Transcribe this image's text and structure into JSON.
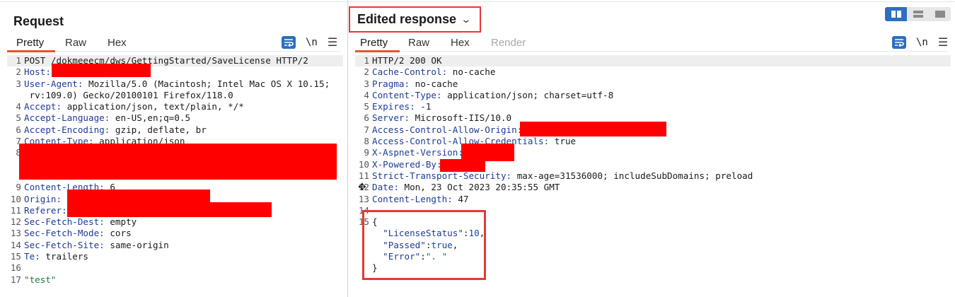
{
  "request": {
    "title": "Request",
    "tabs": [
      "Pretty",
      "Raw",
      "Hex"
    ],
    "newline_label": "\\n",
    "lines": [
      {
        "n": "1",
        "key": "POST /dokmeeecm/dws/GettingStarted/SaveLicense HTTP/2",
        "val": ""
      },
      {
        "n": "2",
        "key": "Host:",
        "val": ""
      },
      {
        "n": "3",
        "key": "User-Agent:",
        "val": " Mozilla/5.0 (Macintosh; Intel Mac OS X 10.15;"
      },
      {
        "n": "",
        "key": "",
        "val": " rv:109.0) Gecko/20100101 Firefox/118.0"
      },
      {
        "n": "4",
        "key": "Accept:",
        "val": " application/json, text/plain, */*"
      },
      {
        "n": "5",
        "key": "Accept-Language:",
        "val": " en-US,en;q=0.5"
      },
      {
        "n": "6",
        "key": "Accept-Encoding:",
        "val": " gzip, deflate, br"
      },
      {
        "n": "7",
        "key": "Content-Type:",
        "val": " application/json"
      },
      {
        "n": "8",
        "key": "",
        "val": ""
      },
      {
        "n": "",
        "key": "",
        "val": ""
      },
      {
        "n": "",
        "key": "",
        "val": ""
      },
      {
        "n": "9",
        "key": "Content-Length:",
        "val": " 6"
      },
      {
        "n": "10",
        "key": "Origin:",
        "val": ""
      },
      {
        "n": "11",
        "key": "Referer:",
        "val": ""
      },
      {
        "n": "12",
        "key": "Sec-Fetch-Dest:",
        "val": " empty"
      },
      {
        "n": "13",
        "key": "Sec-Fetch-Mode:",
        "val": " cors"
      },
      {
        "n": "14",
        "key": "Sec-Fetch-Site:",
        "val": " same-origin"
      },
      {
        "n": "15",
        "key": "Te:",
        "val": " trailers"
      },
      {
        "n": "16",
        "key": "",
        "val": ""
      },
      {
        "n": "17",
        "key": "",
        "val": "\"test\""
      }
    ]
  },
  "response": {
    "title": "Edited response",
    "tabs": [
      "Pretty",
      "Raw",
      "Hex",
      "Render"
    ],
    "newline_label": "\\n",
    "lines": [
      {
        "n": "1",
        "key": "HTTP/2 200 OK",
        "val": ""
      },
      {
        "n": "2",
        "key": "Cache-Control:",
        "val": " no-cache"
      },
      {
        "n": "3",
        "key": "Pragma:",
        "val": " no-cache"
      },
      {
        "n": "4",
        "key": "Content-Type:",
        "val": " application/json; charset=utf-8"
      },
      {
        "n": "5",
        "key": "Expires:",
        "val": " -1"
      },
      {
        "n": "6",
        "key": "Server:",
        "val": " Microsoft-IIS/10.0"
      },
      {
        "n": "7",
        "key": "Access-Control-Allow-Origin:",
        "val": ""
      },
      {
        "n": "8",
        "key": "Access-Control-Allow-Credentials:",
        "val": " true"
      },
      {
        "n": "9",
        "key": "X-Aspnet-Version:",
        "val": ""
      },
      {
        "n": "10",
        "key": "X-Powered-By:",
        "val": ""
      },
      {
        "n": "11",
        "key": "Strict-Transport-Security:",
        "val": " max-age=31536000; includeSubDomains; preload"
      },
      {
        "n": "12",
        "key": "Date:",
        "val": " Mon, 23 Oct 2023 20:35:55 GMT"
      },
      {
        "n": "13",
        "key": "Content-Length:",
        "val": " 47"
      },
      {
        "n": "14",
        "key": "",
        "val": ""
      },
      {
        "n": "15",
        "key": "",
        "val": "{"
      }
    ],
    "json_lines": [
      {
        "key": "\"LicenseStatus\"",
        "sep": ":",
        "val": "10",
        "end": ","
      },
      {
        "key": "\"Passed\"",
        "sep": ":",
        "val": "true",
        "end": ","
      },
      {
        "key": "\"Error\"",
        "sep": ":",
        "val": "\". \"",
        "end": ""
      }
    ],
    "json_close": "}"
  },
  "colors": {
    "accent_tab": "#e8542b",
    "highlight_box": "#e53935",
    "redaction": "#ff0000",
    "toggle_blue": "#2d6fbd"
  },
  "icons": [
    "chevron-down-icon",
    "wrap-lines-icon",
    "menu-icon",
    "layout-side-by-side-icon",
    "layout-stacked-icon",
    "layout-single-icon",
    "move-cursor-icon"
  ]
}
